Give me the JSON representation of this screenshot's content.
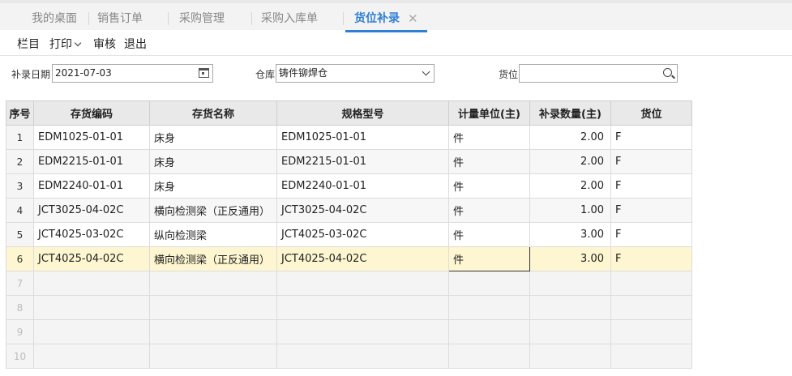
{
  "tabs": [
    {
      "label": "我的桌面",
      "active": false
    },
    {
      "label": "销售订单",
      "active": false
    },
    {
      "label": "采购管理",
      "active": false
    },
    {
      "label": "采购入库单",
      "active": false
    },
    {
      "label": "货位补录",
      "active": true
    }
  ],
  "toolbar": {
    "columns": "栏目",
    "print": "打印",
    "audit": "审核",
    "exit": "退出"
  },
  "filters": {
    "date_label": "补录日期",
    "date_value": "2021-07-03",
    "warehouse_label": "仓库",
    "warehouse_value": "铸件铆焊仓",
    "location_label": "货位",
    "location_value": ""
  },
  "table": {
    "headers": [
      "序号",
      "存货编码",
      "存货名称",
      "规格型号",
      "计量单位(主)",
      "补录数量(主)",
      "货位"
    ],
    "rows": [
      {
        "seq": "1",
        "code": "EDM1025-01-01",
        "name": "床身",
        "spec": "EDM1025-01-01",
        "unit": "件",
        "qty": "2.00",
        "loc": "F"
      },
      {
        "seq": "2",
        "code": "EDM2215-01-01",
        "name": "床身",
        "spec": "EDM2215-01-01",
        "unit": "件",
        "qty": "2.00",
        "loc": "F"
      },
      {
        "seq": "3",
        "code": "EDM2240-01-01",
        "name": "床身",
        "spec": "EDM2240-01-01",
        "unit": "件",
        "qty": "2.00",
        "loc": "F"
      },
      {
        "seq": "4",
        "code": "JCT3025-04-02C",
        "name": "横向检测梁（正反通用）",
        "spec": "JCT3025-04-02C",
        "unit": "件",
        "qty": "1.00",
        "loc": "F"
      },
      {
        "seq": "5",
        "code": "JCT4025-03-02C",
        "name": "纵向检测梁",
        "spec": "JCT4025-03-02C",
        "unit": "件",
        "qty": "3.00",
        "loc": "F"
      },
      {
        "seq": "6",
        "code": "JCT4025-04-02C",
        "name": "横向检测梁（正反通用）",
        "spec": "JCT4025-04-02C",
        "unit": "件",
        "qty": "3.00",
        "loc": "F"
      }
    ],
    "empty_rows": [
      "7",
      "8",
      "9",
      "10"
    ]
  }
}
